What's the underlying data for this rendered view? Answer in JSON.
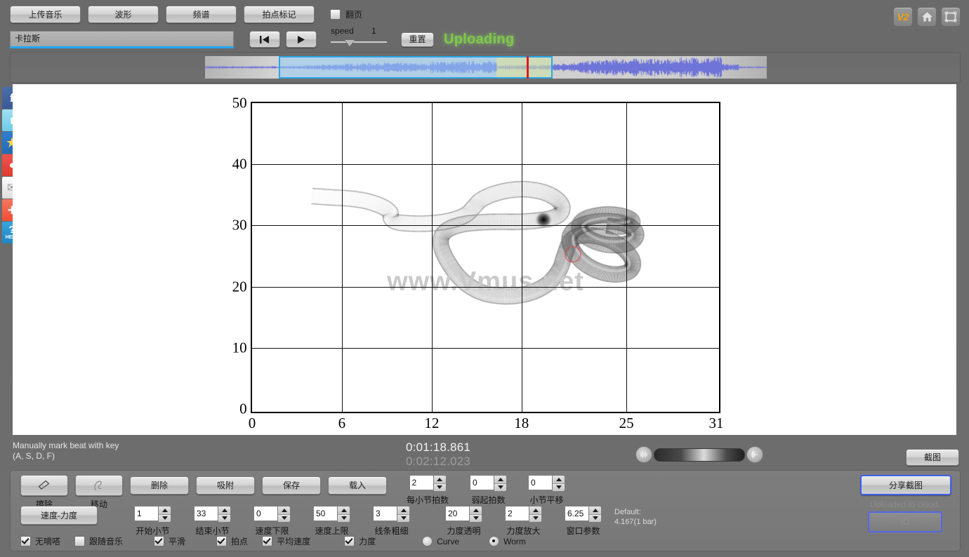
{
  "top": {
    "tabs": [
      {
        "label": "上传音乐",
        "name": "tab-upload-music"
      },
      {
        "label": "波形",
        "name": "tab-waveform"
      },
      {
        "label": "频谱",
        "name": "tab-spectrum"
      },
      {
        "label": "拍点标记",
        "name": "tab-beat-marks"
      }
    ],
    "page_turn_label": "翻页",
    "page_turn_checked": false,
    "song_title": "卡拉斯",
    "song_placeholder": "卡拉斯",
    "speed_label": "speed",
    "speed_value": "1",
    "reset_label": "重置",
    "status_text": "Uploading",
    "status_color": "#7ec84b",
    "badge_v2": "V2",
    "icons": [
      "v2-badge",
      "home-icon",
      "fullscreen-icon"
    ]
  },
  "chart_data": {
    "type": "line",
    "title": "",
    "xlabel": "",
    "ylabel": "",
    "xticks": [
      0,
      6,
      12,
      18,
      25,
      31
    ],
    "yticks": [
      0,
      10,
      20,
      30,
      40,
      50
    ],
    "xlim": [
      0,
      31
    ],
    "ylim": [
      0,
      50
    ],
    "grid": true,
    "legend": "none",
    "watermark": "www.Vmus.net",
    "series": [
      {
        "name": "tempo-dynamics-worm",
        "comment": "3D tube (worm) trajectory of tempo vs dynamics; x in bars 0-31, y 0-50",
        "points": [
          [
            4.0,
            34.8
          ],
          [
            5.2,
            34.6
          ],
          [
            6.5,
            34.4
          ],
          [
            7.6,
            34.0
          ],
          [
            8.6,
            33.2
          ],
          [
            9.2,
            32.2
          ],
          [
            9.3,
            31.1
          ],
          [
            9.8,
            30.5
          ],
          [
            10.9,
            30.3
          ],
          [
            12.2,
            30.4
          ],
          [
            13.4,
            30.9
          ],
          [
            14.3,
            31.8
          ],
          [
            14.8,
            33.0
          ],
          [
            15.3,
            34.2
          ],
          [
            16.2,
            35.2
          ],
          [
            17.3,
            35.8
          ],
          [
            18.4,
            35.9
          ],
          [
            19.5,
            35.4
          ],
          [
            20.3,
            34.4
          ],
          [
            20.7,
            33.2
          ],
          [
            20.6,
            32.0
          ],
          [
            20.0,
            31.2
          ],
          [
            19.0,
            30.8
          ],
          [
            17.7,
            30.6
          ],
          [
            16.4,
            30.6
          ],
          [
            15.2,
            30.5
          ],
          [
            14.1,
            30.2
          ],
          [
            13.2,
            29.5
          ],
          [
            12.7,
            28.4
          ],
          [
            12.6,
            27.0
          ],
          [
            12.8,
            25.4
          ],
          [
            13.2,
            23.6
          ],
          [
            13.7,
            21.9
          ],
          [
            14.4,
            20.3
          ],
          [
            15.3,
            19.1
          ],
          [
            16.4,
            18.5
          ],
          [
            17.6,
            18.5
          ],
          [
            18.7,
            19.1
          ],
          [
            19.6,
            20.2
          ],
          [
            20.2,
            21.6
          ],
          [
            20.6,
            23.1
          ],
          [
            20.8,
            24.6
          ],
          [
            21.0,
            26.0
          ],
          [
            21.2,
            27.2
          ],
          [
            21.6,
            28.1
          ],
          [
            22.3,
            28.4
          ],
          [
            23.1,
            28.2
          ],
          [
            23.9,
            27.6
          ],
          [
            24.6,
            26.6
          ],
          [
            25.1,
            25.5
          ],
          [
            25.4,
            24.3
          ],
          [
            25.4,
            23.2
          ],
          [
            25.1,
            22.4
          ],
          [
            24.4,
            22.0
          ],
          [
            23.6,
            22.2
          ],
          [
            22.8,
            22.9
          ],
          [
            22.1,
            24.0
          ],
          [
            21.6,
            25.3
          ],
          [
            21.3,
            26.6
          ],
          [
            21.2,
            27.9
          ],
          [
            21.4,
            29.0
          ],
          [
            21.9,
            29.9
          ],
          [
            22.7,
            30.5
          ],
          [
            23.6,
            30.7
          ],
          [
            24.5,
            30.5
          ],
          [
            25.2,
            29.9
          ],
          [
            25.6,
            29.0
          ],
          [
            25.6,
            28.0
          ],
          [
            25.2,
            27.2
          ],
          [
            24.5,
            26.8
          ],
          [
            23.6,
            26.9
          ],
          [
            22.8,
            27.5
          ],
          [
            22.2,
            28.4
          ],
          [
            21.9,
            29.4
          ],
          [
            21.9,
            30.3
          ],
          [
            22.3,
            31.1
          ],
          [
            23.0,
            31.6
          ],
          [
            23.8,
            31.8
          ],
          [
            24.6,
            31.6
          ],
          [
            25.2,
            31.1
          ],
          [
            25.4,
            30.5
          ],
          [
            25.1,
            30.0
          ],
          [
            24.4,
            29.8
          ],
          [
            23.7,
            30.0
          ]
        ]
      }
    ]
  },
  "waveform": {
    "selection_start_label": "selection",
    "playhead_label": "playhead"
  },
  "footer": {
    "hint_line1": "Manually mark beat with key",
    "hint_line2": "(A, S, D, F)",
    "time_current": "0:01:18.861",
    "time_total": "0:02:12.023",
    "snapshot_label": "截图"
  },
  "panel": {
    "tools": [
      {
        "label": "擦除",
        "name": "tool-erase",
        "icon": "eraser-icon"
      },
      {
        "label": "移动",
        "name": "tool-move",
        "icon": "hand-move-icon"
      }
    ],
    "actions": [
      {
        "label": "删除",
        "name": "delete-button"
      },
      {
        "label": "吸附",
        "name": "snap-button"
      },
      {
        "label": "保存",
        "name": "save-button"
      },
      {
        "label": "载入",
        "name": "load-button"
      }
    ],
    "row1_spinners": [
      {
        "label": "每小节拍数",
        "value": "2",
        "name": "beats-per-bar-stepper"
      },
      {
        "label": "弱起拍数",
        "value": "0",
        "name": "pickup-beats-stepper"
      },
      {
        "label": "小节平移",
        "value": "0",
        "name": "bar-shift-stepper"
      }
    ],
    "tempo_dynamics_label": "速度-力度",
    "row2_spinners": [
      {
        "label": "开始小节",
        "value": "1",
        "name": "start-bar-stepper"
      },
      {
        "label": "结束小节",
        "value": "33",
        "name": "end-bar-stepper"
      },
      {
        "label": "速度下限",
        "value": "0",
        "name": "tempo-min-stepper"
      },
      {
        "label": "速度上限",
        "value": "50",
        "name": "tempo-max-stepper"
      },
      {
        "label": "线条粗细",
        "value": "3",
        "name": "line-width-stepper"
      },
      {
        "label": "力度透明",
        "value": "20",
        "name": "dynamics-opacity-stepper"
      },
      {
        "label": "力度放大",
        "value": "2",
        "name": "dynamics-scale-stepper"
      },
      {
        "label": "窗口参数",
        "value": "6.25",
        "name": "window-param-stepper"
      }
    ],
    "default_line1": "Default:",
    "default_line2": "4.167(1 bar)",
    "checkboxes": [
      {
        "label": "无嘀嗒",
        "checked": true,
        "name": "checkbox-no-tick"
      },
      {
        "label": "跟随音乐",
        "checked": false,
        "name": "checkbox-follow-music"
      },
      {
        "label": "平滑",
        "checked": true,
        "name": "checkbox-smooth"
      },
      {
        "label": "拍点",
        "checked": true,
        "name": "checkbox-beat-points"
      },
      {
        "label": "平均速度",
        "checked": true,
        "name": "checkbox-average-tempo"
      },
      {
        "label": "力度",
        "checked": true,
        "name": "checkbox-dynamics"
      }
    ],
    "radios": [
      {
        "label": "Curve",
        "selected": false,
        "name": "radio-curve"
      },
      {
        "label": "Worm",
        "selected": true,
        "name": "radio-worm"
      }
    ],
    "share_label": "分享截图",
    "uploaded_text": "Uploaded to cloud.",
    "io_label": "IO"
  },
  "social": [
    {
      "name": "facebook-icon",
      "glyph": "f"
    },
    {
      "name": "twitter-icon",
      "glyph": "t"
    },
    {
      "name": "qzone-icon",
      "glyph": "★"
    },
    {
      "name": "weibo-icon",
      "glyph": "●"
    },
    {
      "name": "email-icon",
      "glyph": "✉"
    },
    {
      "name": "share-more-icon",
      "glyph": "+"
    },
    {
      "name": "help-icon",
      "glyph": "?",
      "sub": "HELP"
    }
  ]
}
